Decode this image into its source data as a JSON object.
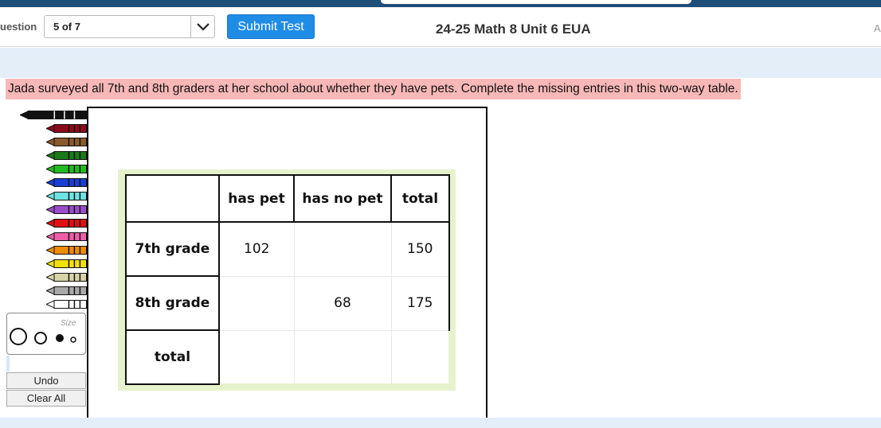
{
  "header": {
    "question_label": "uestion",
    "question_select_value": "5 of 7",
    "submit_label": "Submit Test",
    "test_title": "24-25 Math 8 Unit 6 EUA",
    "right_letter": "A"
  },
  "prompt": "Jada surveyed all 7th and 8th graders at her school about whether they have pets. Complete the missing entries in this two-way table.",
  "tools": {
    "size_label": "Size",
    "undo_label": "Undo",
    "clear_label": "Clear All",
    "crayon_colors": [
      "#111111",
      "#8b0a1a",
      "#8a5a2b",
      "#1a7a1a",
      "#22bb22",
      "#1a3fd6",
      "#6fe3e3",
      "#9b4dc9",
      "#e01010",
      "#ee5fa7",
      "#f08c00",
      "#f2e100",
      "#d9d4a8",
      "#a8a8a8",
      "#ffffff"
    ]
  },
  "table": {
    "headers": [
      "",
      "has pet",
      "has no pet",
      "total"
    ],
    "rows": [
      {
        "label": "7th grade",
        "has_pet": "102",
        "has_no_pet": "",
        "total": "150"
      },
      {
        "label": "8th grade",
        "has_pet": "",
        "has_no_pet": "68",
        "total": "175"
      },
      {
        "label": "total",
        "has_pet": "",
        "has_no_pet": "",
        "total": ""
      }
    ]
  }
}
